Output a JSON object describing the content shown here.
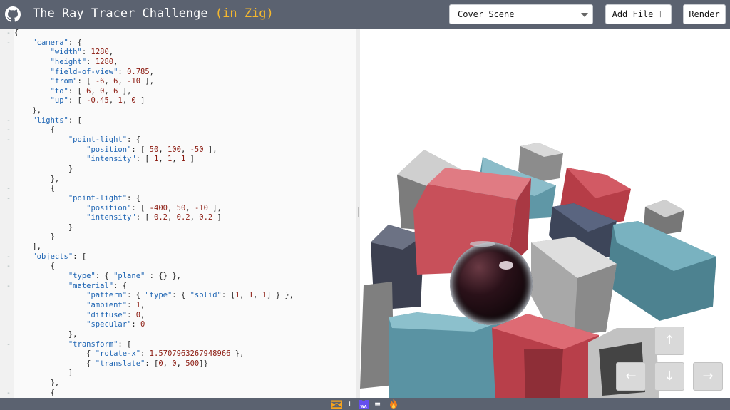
{
  "header": {
    "title": "The Ray Tracer Challenge",
    "title_accent": "(in Zig)",
    "scene_select": {
      "value": "Cover Scene"
    },
    "add_file_label": "Add File",
    "add_file_icon": "plus-icon",
    "render_label": "Render",
    "github_icon": "github-icon",
    "colors": {
      "bar": "#5b6270",
      "accent": "#f5b82e"
    }
  },
  "editor": {
    "lines": [
      {
        "fold": true,
        "tokens": [
          [
            "p",
            "{"
          ]
        ]
      },
      {
        "fold": true,
        "tokens": [
          [
            "p",
            "    "
          ],
          [
            "k",
            "\"camera\""
          ],
          [
            "p",
            ": {"
          ]
        ]
      },
      {
        "fold": false,
        "tokens": [
          [
            "p",
            "        "
          ],
          [
            "k",
            "\"width\""
          ],
          [
            "p",
            ": "
          ],
          [
            "n",
            "1280"
          ],
          [
            "p",
            ","
          ]
        ]
      },
      {
        "fold": false,
        "tokens": [
          [
            "p",
            "        "
          ],
          [
            "k",
            "\"height\""
          ],
          [
            "p",
            ": "
          ],
          [
            "n",
            "1280"
          ],
          [
            "p",
            ","
          ]
        ]
      },
      {
        "fold": false,
        "tokens": [
          [
            "p",
            "        "
          ],
          [
            "k",
            "\"field-of-view\""
          ],
          [
            "p",
            ": "
          ],
          [
            "n",
            "0.785"
          ],
          [
            "p",
            ","
          ]
        ]
      },
      {
        "fold": false,
        "tokens": [
          [
            "p",
            "        "
          ],
          [
            "k",
            "\"from\""
          ],
          [
            "p",
            ": [ "
          ],
          [
            "n",
            "-6"
          ],
          [
            "p",
            ", "
          ],
          [
            "n",
            "6"
          ],
          [
            "p",
            ", "
          ],
          [
            "n",
            "-10"
          ],
          [
            "p",
            " ],"
          ]
        ]
      },
      {
        "fold": false,
        "tokens": [
          [
            "p",
            "        "
          ],
          [
            "k",
            "\"to\""
          ],
          [
            "p",
            ": [ "
          ],
          [
            "n",
            "6"
          ],
          [
            "p",
            ", "
          ],
          [
            "n",
            "0"
          ],
          [
            "p",
            ", "
          ],
          [
            "n",
            "6"
          ],
          [
            "p",
            " ],"
          ]
        ]
      },
      {
        "fold": false,
        "tokens": [
          [
            "p",
            "        "
          ],
          [
            "k",
            "\"up\""
          ],
          [
            "p",
            ": [ "
          ],
          [
            "n",
            "-0.45"
          ],
          [
            "p",
            ", "
          ],
          [
            "n",
            "1"
          ],
          [
            "p",
            ", "
          ],
          [
            "n",
            "0"
          ],
          [
            "p",
            " ]"
          ]
        ]
      },
      {
        "fold": false,
        "tokens": [
          [
            "p",
            "    },"
          ]
        ]
      },
      {
        "fold": true,
        "tokens": [
          [
            "p",
            "    "
          ],
          [
            "k",
            "\"lights\""
          ],
          [
            "p",
            ": ["
          ]
        ]
      },
      {
        "fold": true,
        "tokens": [
          [
            "p",
            "        {"
          ]
        ]
      },
      {
        "fold": true,
        "tokens": [
          [
            "p",
            "            "
          ],
          [
            "k",
            "\"point-light\""
          ],
          [
            "p",
            ": {"
          ]
        ]
      },
      {
        "fold": false,
        "tokens": [
          [
            "p",
            "                "
          ],
          [
            "k",
            "\"position\""
          ],
          [
            "p",
            ": [ "
          ],
          [
            "n",
            "50"
          ],
          [
            "p",
            ", "
          ],
          [
            "n",
            "100"
          ],
          [
            "p",
            ", "
          ],
          [
            "n",
            "-50"
          ],
          [
            "p",
            " ],"
          ]
        ]
      },
      {
        "fold": false,
        "tokens": [
          [
            "p",
            "                "
          ],
          [
            "k",
            "\"intensity\""
          ],
          [
            "p",
            ": [ "
          ],
          [
            "n",
            "1"
          ],
          [
            "p",
            ", "
          ],
          [
            "n",
            "1"
          ],
          [
            "p",
            ", "
          ],
          [
            "n",
            "1"
          ],
          [
            "p",
            " ]"
          ]
        ]
      },
      {
        "fold": false,
        "tokens": [
          [
            "p",
            "            }"
          ]
        ]
      },
      {
        "fold": false,
        "tokens": [
          [
            "p",
            "        },"
          ]
        ]
      },
      {
        "fold": true,
        "tokens": [
          [
            "p",
            "        {"
          ]
        ]
      },
      {
        "fold": true,
        "tokens": [
          [
            "p",
            "            "
          ],
          [
            "k",
            "\"point-light\""
          ],
          [
            "p",
            ": {"
          ]
        ]
      },
      {
        "fold": false,
        "tokens": [
          [
            "p",
            "                "
          ],
          [
            "k",
            "\"position\""
          ],
          [
            "p",
            ": [ "
          ],
          [
            "n",
            "-400"
          ],
          [
            "p",
            ", "
          ],
          [
            "n",
            "50"
          ],
          [
            "p",
            ", "
          ],
          [
            "n",
            "-10"
          ],
          [
            "p",
            " ],"
          ]
        ]
      },
      {
        "fold": false,
        "tokens": [
          [
            "p",
            "                "
          ],
          [
            "k",
            "\"intensity\""
          ],
          [
            "p",
            ": [ "
          ],
          [
            "n",
            "0.2"
          ],
          [
            "p",
            ", "
          ],
          [
            "n",
            "0.2"
          ],
          [
            "p",
            ", "
          ],
          [
            "n",
            "0.2"
          ],
          [
            "p",
            " ]"
          ]
        ]
      },
      {
        "fold": false,
        "tokens": [
          [
            "p",
            "            }"
          ]
        ]
      },
      {
        "fold": false,
        "tokens": [
          [
            "p",
            "        }"
          ]
        ]
      },
      {
        "fold": false,
        "tokens": [
          [
            "p",
            "    ],"
          ]
        ]
      },
      {
        "fold": true,
        "tokens": [
          [
            "p",
            "    "
          ],
          [
            "k",
            "\"objects\""
          ],
          [
            "p",
            ": ["
          ]
        ]
      },
      {
        "fold": true,
        "tokens": [
          [
            "p",
            "        {"
          ]
        ]
      },
      {
        "fold": false,
        "tokens": [
          [
            "p",
            "            "
          ],
          [
            "k",
            "\"type\""
          ],
          [
            "p",
            ": { "
          ],
          [
            "k",
            "\"plane\""
          ],
          [
            "p",
            " : {} },"
          ]
        ]
      },
      {
        "fold": true,
        "tokens": [
          [
            "p",
            "            "
          ],
          [
            "k",
            "\"material\""
          ],
          [
            "p",
            ": {"
          ]
        ]
      },
      {
        "fold": false,
        "tokens": [
          [
            "p",
            "                "
          ],
          [
            "k",
            "\"pattern\""
          ],
          [
            "p",
            ": { "
          ],
          [
            "k",
            "\"type\""
          ],
          [
            "p",
            ": { "
          ],
          [
            "k",
            "\"solid\""
          ],
          [
            "p",
            ": ["
          ],
          [
            "n",
            "1"
          ],
          [
            "p",
            ", "
          ],
          [
            "n",
            "1"
          ],
          [
            "p",
            ", "
          ],
          [
            "n",
            "1"
          ],
          [
            "p",
            "] } },"
          ]
        ]
      },
      {
        "fold": false,
        "tokens": [
          [
            "p",
            "                "
          ],
          [
            "k",
            "\"ambient\""
          ],
          [
            "p",
            ": "
          ],
          [
            "n",
            "1"
          ],
          [
            "p",
            ","
          ]
        ]
      },
      {
        "fold": false,
        "tokens": [
          [
            "p",
            "                "
          ],
          [
            "k",
            "\"diffuse\""
          ],
          [
            "p",
            ": "
          ],
          [
            "n",
            "0"
          ],
          [
            "p",
            ","
          ]
        ]
      },
      {
        "fold": false,
        "tokens": [
          [
            "p",
            "                "
          ],
          [
            "k",
            "\"specular\""
          ],
          [
            "p",
            ": "
          ],
          [
            "n",
            "0"
          ]
        ]
      },
      {
        "fold": false,
        "tokens": [
          [
            "p",
            "            },"
          ]
        ]
      },
      {
        "fold": true,
        "tokens": [
          [
            "p",
            "            "
          ],
          [
            "k",
            "\"transform\""
          ],
          [
            "p",
            ": ["
          ]
        ]
      },
      {
        "fold": false,
        "tokens": [
          [
            "p",
            "                { "
          ],
          [
            "k",
            "\"rotate-x\""
          ],
          [
            "p",
            ": "
          ],
          [
            "n",
            "1.5707963267948966"
          ],
          [
            "p",
            " },"
          ]
        ]
      },
      {
        "fold": false,
        "tokens": [
          [
            "p",
            "                { "
          ],
          [
            "k",
            "\"translate\""
          ],
          [
            "p",
            ": ["
          ],
          [
            "n",
            "0"
          ],
          [
            "p",
            ", "
          ],
          [
            "n",
            "0"
          ],
          [
            "p",
            ", "
          ],
          [
            "n",
            "500"
          ],
          [
            "p",
            "]}"
          ]
        ]
      },
      {
        "fold": false,
        "tokens": [
          [
            "p",
            "            ]"
          ]
        ]
      },
      {
        "fold": false,
        "tokens": [
          [
            "p",
            "        },"
          ]
        ]
      },
      {
        "fold": true,
        "tokens": [
          [
            "p",
            "        {"
          ]
        ]
      }
    ]
  },
  "viewport": {
    "arrows": {
      "up": "arrow-up-icon",
      "left": "arrow-left-icon",
      "down": "arrow-down-icon",
      "right": "arrow-right-icon"
    }
  },
  "footer": {
    "items": [
      "zig-logo-icon",
      "+",
      "wasm-logo-icon",
      "=",
      "fire-icon"
    ],
    "plus": "+",
    "equals": "="
  }
}
